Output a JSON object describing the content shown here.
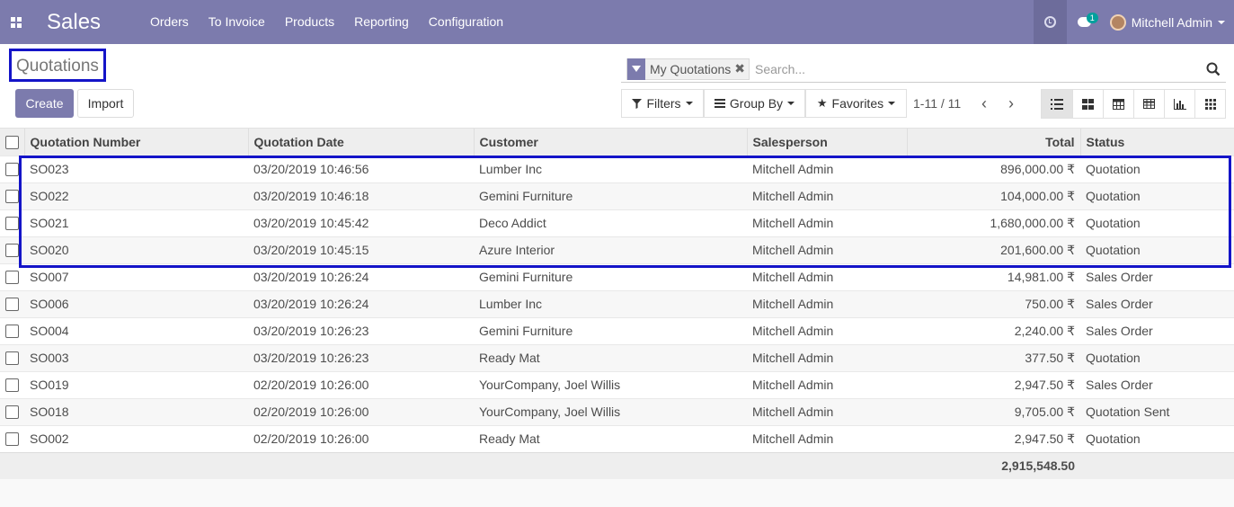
{
  "navbar": {
    "app_title": "Sales",
    "menu": [
      "Orders",
      "To Invoice",
      "Products",
      "Reporting",
      "Configuration"
    ],
    "chat_badge": "1",
    "user_name": "Mitchell Admin",
    "bg_color": "#7c7bad"
  },
  "control": {
    "breadcrumb": "Quotations",
    "create_label": "Create",
    "import_label": "Import",
    "facet_label": "My Quotations",
    "facet_remove": "✖",
    "search_placeholder": "Search...",
    "filters_label": "Filters",
    "groupby_label": "Group By",
    "favorites_label": "Favorites",
    "pager": "1-11 / 11",
    "pager_prev": "‹",
    "pager_next": "›",
    "views": [
      "list-view-icon",
      "kanban-view-icon",
      "calendar-view-icon",
      "pivot-view-icon",
      "graph-view-icon",
      "activity-view-icon"
    ]
  },
  "table": {
    "columns": [
      "Quotation Number",
      "Quotation Date",
      "Customer",
      "Salesperson",
      "Total",
      "Status"
    ],
    "rows": [
      {
        "number": "SO023",
        "date": "03/20/2019 10:46:56",
        "customer": "Lumber Inc",
        "salesperson": "Mitchell Admin",
        "total": "896,000.00 ₹",
        "status": "Quotation"
      },
      {
        "number": "SO022",
        "date": "03/20/2019 10:46:18",
        "customer": "Gemini Furniture",
        "salesperson": "Mitchell Admin",
        "total": "104,000.00 ₹",
        "status": "Quotation"
      },
      {
        "number": "SO021",
        "date": "03/20/2019 10:45:42",
        "customer": "Deco Addict",
        "salesperson": "Mitchell Admin",
        "total": "1,680,000.00 ₹",
        "status": "Quotation"
      },
      {
        "number": "SO020",
        "date": "03/20/2019 10:45:15",
        "customer": "Azure Interior",
        "salesperson": "Mitchell Admin",
        "total": "201,600.00 ₹",
        "status": "Quotation"
      },
      {
        "number": "SO007",
        "date": "03/20/2019 10:26:24",
        "customer": "Gemini Furniture",
        "salesperson": "Mitchell Admin",
        "total": "14,981.00 ₹",
        "status": "Sales Order"
      },
      {
        "number": "SO006",
        "date": "03/20/2019 10:26:24",
        "customer": "Lumber Inc",
        "salesperson": "Mitchell Admin",
        "total": "750.00 ₹",
        "status": "Sales Order"
      },
      {
        "number": "SO004",
        "date": "03/20/2019 10:26:23",
        "customer": "Gemini Furniture",
        "salesperson": "Mitchell Admin",
        "total": "2,240.00 ₹",
        "status": "Sales Order"
      },
      {
        "number": "SO003",
        "date": "03/20/2019 10:26:23",
        "customer": "Ready Mat",
        "salesperson": "Mitchell Admin",
        "total": "377.50 ₹",
        "status": "Quotation"
      },
      {
        "number": "SO019",
        "date": "02/20/2019 10:26:00",
        "customer": "YourCompany, Joel Willis",
        "salesperson": "Mitchell Admin",
        "total": "2,947.50 ₹",
        "status": "Sales Order"
      },
      {
        "number": "SO018",
        "date": "02/20/2019 10:26:00",
        "customer": "YourCompany, Joel Willis",
        "salesperson": "Mitchell Admin",
        "total": "9,705.00 ₹",
        "status": "Quotation Sent"
      },
      {
        "number": "SO002",
        "date": "02/20/2019 10:26:00",
        "customer": "Ready Mat",
        "salesperson": "Mitchell Admin",
        "total": "2,947.50 ₹",
        "status": "Quotation"
      }
    ],
    "footer_total": "2,915,548.50"
  }
}
